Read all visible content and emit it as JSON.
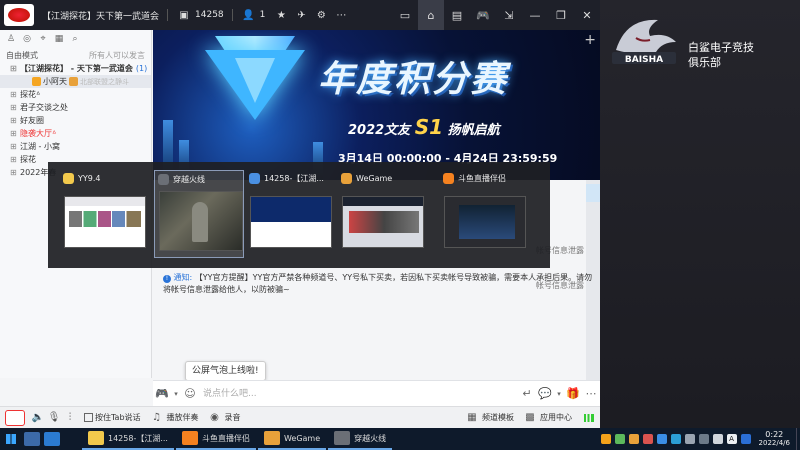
{
  "window": {
    "channel_title": "【江湖探花】天下第一武道会",
    "channel_id": "14258",
    "online_count": "1",
    "nav_buttons": [
      "live-icon",
      "home-icon",
      "list-icon",
      "gamepad-icon",
      "collapse-icon",
      "minimize-icon",
      "restore-icon",
      "close-icon"
    ]
  },
  "left_panel": {
    "mode_label": "自由模式",
    "mode_note": "所有人可以发言",
    "tree": [
      {
        "text": "【江湖探花】 - 天下第一武道会",
        "count": "(1)",
        "kind": "root"
      },
      {
        "text": "小阿天",
        "extra": "北部联盟之静斗",
        "kind": "sub"
      },
      {
        "text": "探花ᐞ",
        "kind": "plain"
      },
      {
        "text": "君子交谈之处",
        "kind": "plain"
      },
      {
        "text": "好友圈",
        "kind": "plain"
      },
      {
        "text": "隐袭大厅ᐞ",
        "kind": "red"
      },
      {
        "text": "江湖 - 小窝",
        "kind": "plain"
      },
      {
        "text": "探花",
        "kind": "plain"
      },
      {
        "text": "2022年春",
        "kind": "plain"
      }
    ]
  },
  "banner": {
    "title": "年度积分赛",
    "subtitle_pre": "2022文友",
    "subtitle_s1": "S1",
    "subtitle_post": "扬帆启航",
    "dates": "3月14日 00:00:00 - 4月24日 23:59:59"
  },
  "switcher": {
    "items": [
      {
        "label": "YY9.4",
        "color": "#f2c94c",
        "thumb": "yy"
      },
      {
        "label": "穿越火线",
        "color": "#6b6f76",
        "thumb": "game",
        "active": true
      },
      {
        "label": "14258-【江湖...",
        "color": "#4a90e2",
        "thumb": "banner"
      },
      {
        "label": "WeGame",
        "color": "#e8a13a",
        "thumb": "wegame"
      },
      {
        "label": "斗鱼直播伴侣",
        "color": "#f58220",
        "thumb": "douyu"
      }
    ]
  },
  "chat": {
    "side_text_1": "帐号信息泄露",
    "side_text_2": "帐号信息泄露",
    "notice_label": "通知:",
    "notice_text": "【YY官方提醒】YY官方严禁各种频道号、YY号私下买卖，若因私下买卖帐号导致被骗，需要本人承担后果。请勿将帐号信息泄露给他人，以防被骗~",
    "toast": "公屏气泡上线啦!",
    "input_placeholder": "说点什么吧..."
  },
  "bottom_bar": {
    "tab_talk": "按住Tab说话",
    "music": "播放伴奏",
    "record": "录音",
    "channel_template": "频道模板",
    "app_center": "应用中心"
  },
  "right_panel": {
    "club_name": "白鲨电子竞技俱乐部",
    "logo_text": "BAISHA"
  },
  "taskbar": {
    "tasks": [
      {
        "label": "14258-【江湖...",
        "color": "#f2c94c"
      },
      {
        "label": "斗鱼直播伴侣",
        "color": "#f58220"
      },
      {
        "label": "WeGame",
        "color": "#e8a13a"
      },
      {
        "label": "穿越火线",
        "color": "#6b6f76"
      }
    ],
    "time": "0:22",
    "date": "2022/4/6"
  },
  "colors": {
    "titlebar": "#1e2029",
    "accent_blue": "#2a74d8",
    "red_channel": "#e33333",
    "taskbar": "#0e1a2b"
  }
}
